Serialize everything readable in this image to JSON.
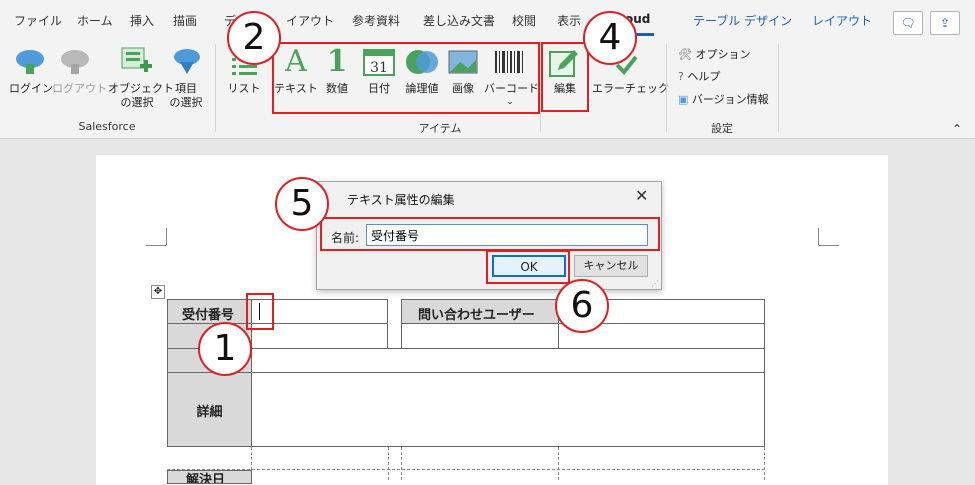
{
  "tabs": [
    {
      "id": "file",
      "label": "ファイル"
    },
    {
      "id": "home",
      "label": "ホーム"
    },
    {
      "id": "insert",
      "label": "挿入"
    },
    {
      "id": "draw",
      "label": "描画"
    },
    {
      "id": "design",
      "label": "デ"
    },
    {
      "id": "layout",
      "label": "イアウト"
    },
    {
      "id": "references",
      "label": "参考資料"
    },
    {
      "id": "mailings",
      "label": "差し込み文書"
    },
    {
      "id": "review",
      "label": "校閲"
    },
    {
      "id": "view",
      "label": "表示"
    },
    {
      "id": "cloud",
      "label": "oud"
    },
    {
      "id": "table-design",
      "label": "テーブル デザイン"
    },
    {
      "id": "table-layout",
      "label": "レイアウト"
    }
  ],
  "ribbon": {
    "salesforce": {
      "group_label": "Salesforce",
      "login": "ログイン",
      "logout": "ログアウト",
      "select_object": [
        "オブジェクト",
        "の選択"
      ],
      "select_field": [
        "項目",
        "の選択"
      ]
    },
    "items": {
      "group_label": "アイテム",
      "list": "リスト",
      "text": "テキスト",
      "number": "数値",
      "date": "日付",
      "boolean": "論理値",
      "image": "画像",
      "barcode": "バーコード",
      "number_glyph": "1",
      "date_glyph": "31",
      "text_glyph": "A"
    },
    "edit": "編集",
    "error_check": "エラーチェック",
    "settings": {
      "group_label": "設定",
      "options": "オプション",
      "help": "ヘルプ",
      "version": "バージョン情報"
    }
  },
  "callouts": [
    "1",
    "2",
    "4",
    "5",
    "6"
  ],
  "dialog": {
    "title": "テキスト属性の編集",
    "name_label": "名前:",
    "name_value": "受付番号",
    "ok": "OK",
    "cancel": "キャンセル"
  },
  "table": {
    "receipt_no": "受付番号",
    "inquiry_user": "問い合わせユーザー",
    "details": "詳細",
    "bottom_partial": "解決日"
  },
  "colors": {
    "accent": "#1d5fb3",
    "highlight": "#e02020",
    "icon_green": "#4aa35a",
    "icon_blue": "#4d9bd8"
  }
}
